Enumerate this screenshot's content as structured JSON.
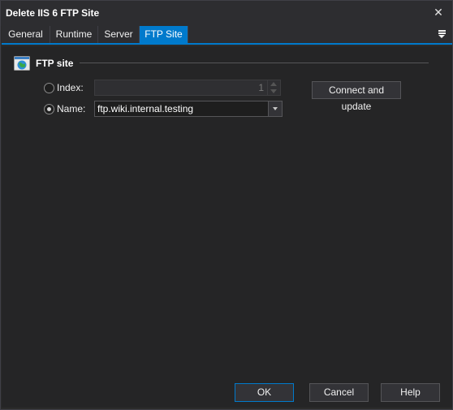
{
  "window": {
    "title": "Delete IIS 6 FTP Site"
  },
  "tabs": [
    {
      "label": "General"
    },
    {
      "label": "Runtime"
    },
    {
      "label": "Server"
    },
    {
      "label": "FTP Site"
    }
  ],
  "section": {
    "title": "FTP site"
  },
  "index": {
    "label": "Index:",
    "value": "1"
  },
  "name": {
    "label": "Name:",
    "value": "ftp.wiki.internal.testing"
  },
  "connect_button": "Connect and update",
  "footer": {
    "ok": "OK",
    "cancel": "Cancel",
    "help": "Help"
  },
  "colors": {
    "accent": "#007acc",
    "background": "#252526"
  }
}
